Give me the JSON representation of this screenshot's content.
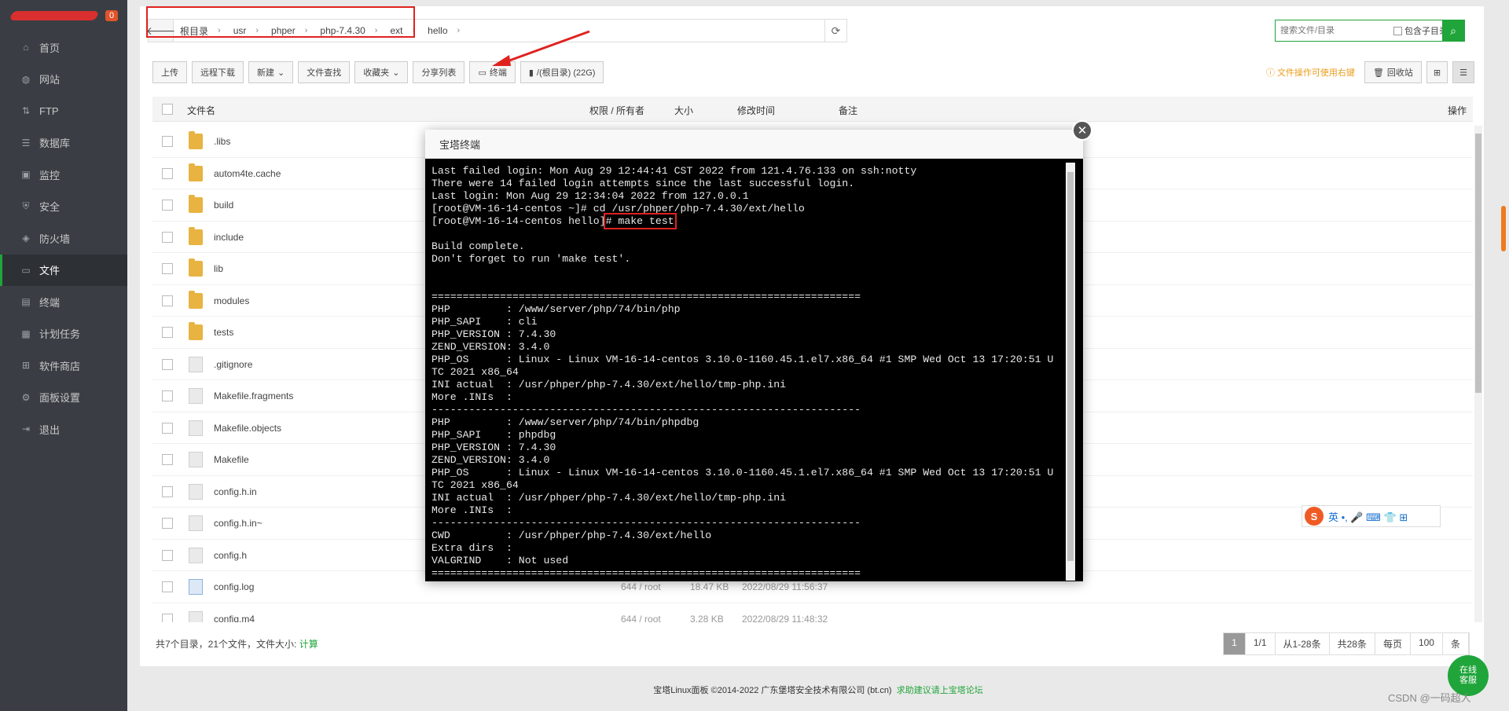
{
  "sidebar": {
    "badge": "0",
    "items": [
      {
        "label": "首页",
        "icon": "home-icon",
        "glyph": "⌂"
      },
      {
        "label": "网站",
        "icon": "globe-icon",
        "glyph": "◍"
      },
      {
        "label": "FTP",
        "icon": "ftp-icon",
        "glyph": "⇅"
      },
      {
        "label": "数据库",
        "icon": "database-icon",
        "glyph": "☰"
      },
      {
        "label": "监控",
        "icon": "monitor-icon",
        "glyph": "▣"
      },
      {
        "label": "安全",
        "icon": "shield-icon",
        "glyph": "⛨"
      },
      {
        "label": "防火墙",
        "icon": "firewall-icon",
        "glyph": "◈"
      },
      {
        "label": "文件",
        "icon": "folder-icon",
        "glyph": "▭"
      },
      {
        "label": "终端",
        "icon": "terminal-icon",
        "glyph": "▤"
      },
      {
        "label": "计划任务",
        "icon": "calendar-icon",
        "glyph": "▦"
      },
      {
        "label": "软件商店",
        "icon": "apps-icon",
        "glyph": "⊞"
      },
      {
        "label": "面板设置",
        "icon": "gear-icon",
        "glyph": "⚙"
      },
      {
        "label": "退出",
        "icon": "logout-icon",
        "glyph": "⇥"
      }
    ],
    "active_index": 7
  },
  "path": {
    "crumbs": [
      "根目录",
      "usr",
      "phper",
      "php-7.4.30",
      "ext",
      "hello"
    ]
  },
  "search": {
    "placeholder": "搜索文件/目录",
    "include_sub_label": "包含子目录"
  },
  "toolbar": {
    "buttons": [
      "上传",
      "远程下载",
      "新建",
      "文件查找",
      "收藏夹",
      "分享列表",
      "终端",
      "/(根目录) (22G)"
    ]
  },
  "right_tools": {
    "tip": "文件操作可使用右键",
    "recycle": "回收站"
  },
  "table": {
    "headers": {
      "name": "文件名",
      "perm": "权限 / 所有者",
      "size": "大小",
      "mtime": "修改时间",
      "note": "备注",
      "action": "操作"
    },
    "rows": [
      {
        "name": ".libs",
        "type": "folder",
        "perm": "",
        "size": "",
        "mtime": ""
      },
      {
        "name": "autom4te.cache",
        "type": "folder",
        "perm": "",
        "size": "",
        "mtime": ""
      },
      {
        "name": "build",
        "type": "folder",
        "perm": "",
        "size": "",
        "mtime": ""
      },
      {
        "name": "include",
        "type": "folder",
        "perm": "",
        "size": "",
        "mtime": ""
      },
      {
        "name": "lib",
        "type": "folder",
        "perm": "",
        "size": "",
        "mtime": ""
      },
      {
        "name": "modules",
        "type": "folder",
        "perm": "",
        "size": "",
        "mtime": ""
      },
      {
        "name": "tests",
        "type": "folder",
        "perm": "",
        "size": "",
        "mtime": ""
      },
      {
        "name": ".gitignore",
        "type": "file",
        "perm": "",
        "size": "",
        "mtime": ""
      },
      {
        "name": "Makefile.fragments",
        "type": "file",
        "perm": "",
        "size": "",
        "mtime": ""
      },
      {
        "name": "Makefile.objects",
        "type": "file",
        "perm": "",
        "size": "",
        "mtime": ""
      },
      {
        "name": "Makefile",
        "type": "file",
        "perm": "",
        "size": "",
        "mtime": ""
      },
      {
        "name": "config.h.in",
        "type": "file",
        "perm": "",
        "size": "",
        "mtime": ""
      },
      {
        "name": "config.h.in~",
        "type": "file",
        "perm": "",
        "size": "",
        "mtime": ""
      },
      {
        "name": "config.h",
        "type": "file",
        "perm": "",
        "size": "",
        "mtime": ""
      },
      {
        "name": "config.log",
        "type": "log",
        "perm": "644 / root",
        "size": "18.47 KB",
        "mtime": "2022/08/29 11:56:37"
      },
      {
        "name": "config.m4",
        "type": "file",
        "perm": "644 / root",
        "size": "3.28 KB",
        "mtime": "2022/08/29 11:48:32"
      }
    ]
  },
  "footer": {
    "stats": "共7个目录，21个文件，文件大小: ",
    "calc_link": "计算",
    "pager": [
      "1",
      "1/1",
      "从1-28条",
      "共28条",
      "每页",
      "100",
      "条"
    ]
  },
  "copyright": {
    "text": "宝塔Linux面板 ©2014-2022 广东堡塔安全技术有限公司 (bt.cn)",
    "link": "求助建议请上宝塔论坛"
  },
  "dialog": {
    "title": "宝塔终端",
    "lines": [
      "Last failed login: Mon Aug 29 12:44:41 CST 2022 from 121.4.76.133 on ssh:notty",
      "There were 14 failed login attempts since the last successful login.",
      "Last login: Mon Aug 29 12:34:04 2022 from 127.0.0.1",
      "[root@VM-16-14-centos ~]# cd /usr/phper/php-7.4.30/ext/hello",
      "[root@VM-16-14-centos hello]# make test",
      "",
      "Build complete.",
      "Don't forget to run 'make test'.",
      "",
      "",
      "=====================================================================",
      "PHP         : /www/server/php/74/bin/php",
      "PHP_SAPI    : cli",
      "PHP_VERSION : 7.4.30",
      "ZEND_VERSION: 3.4.0",
      "PHP_OS      : Linux - Linux VM-16-14-centos 3.10.0-1160.45.1.el7.x86_64 #1 SMP Wed Oct 13 17:20:51 U",
      "TC 2021 x86_64",
      "INI actual  : /usr/phper/php-7.4.30/ext/hello/tmp-php.ini",
      "More .INIs  :",
      "---------------------------------------------------------------------",
      "PHP         : /www/server/php/74/bin/phpdbg",
      "PHP_SAPI    : phpdbg",
      "PHP_VERSION : 7.4.30",
      "ZEND_VERSION: 3.4.0",
      "PHP_OS      : Linux - Linux VM-16-14-centos 3.10.0-1160.45.1.el7.x86_64 #1 SMP Wed Oct 13 17:20:51 U",
      "TC 2021 x86_64",
      "INI actual  : /usr/phper/php-7.4.30/ext/hello/tmp-php.ini",
      "More .INIs  :",
      "---------------------------------------------------------------------",
      "CWD         : /usr/phper/php-7.4.30/ext/hello",
      "Extra dirs  :",
      "VALGRIND    : Not used",
      "====================================================================="
    ],
    "highlight_line": 4,
    "highlight_prefix": "[root@VM-16-14-centos hello]",
    "highlight_text": "# make test"
  },
  "ime": {
    "logo": "S",
    "label": "英 •, 🎤 ⌨ 👕 ⊞"
  },
  "service": {
    "label": "在线\n客服"
  },
  "watermark": "CSDN @一码超人"
}
